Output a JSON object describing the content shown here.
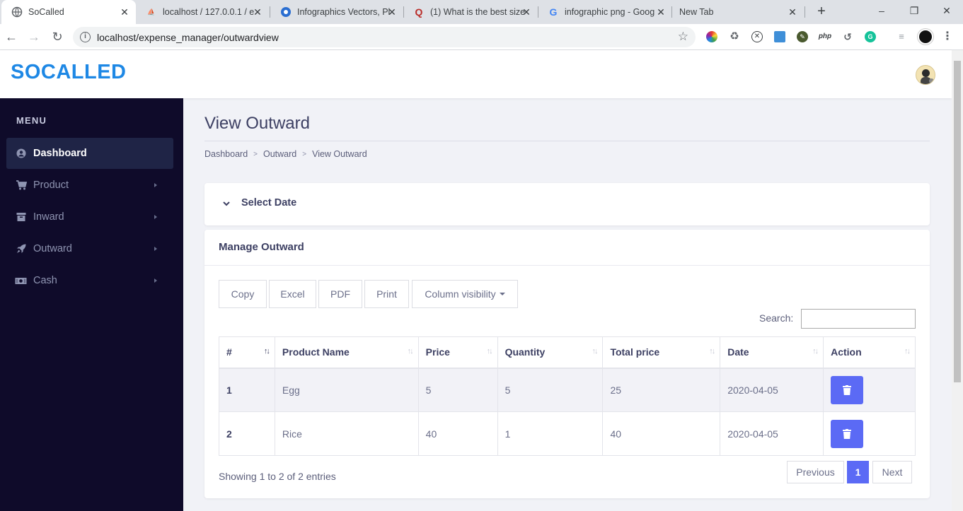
{
  "browser": {
    "tabs": [
      {
        "title": "SoCalled",
        "icon": "globe-icon"
      },
      {
        "title": "localhost / 127.0.0.1 / e",
        "icon": "phpmyadmin-icon"
      },
      {
        "title": "Infographics Vectors, Pl",
        "icon": "freepik-icon"
      },
      {
        "title": "(1) What is the best size",
        "icon": "quora-icon"
      },
      {
        "title": "infographic png - Goog",
        "icon": "google-icon"
      },
      {
        "title": "New Tab",
        "icon": ""
      }
    ],
    "url": "localhost/expense_manager/outwardview",
    "ext_php_label": "php"
  },
  "app": {
    "brand": "SOCALLED"
  },
  "sidebar": {
    "menu_title": "MENU",
    "items": [
      {
        "label": "Dashboard",
        "icon": "user-circle-icon",
        "active": true
      },
      {
        "label": "Product",
        "icon": "cart-icon"
      },
      {
        "label": "Inward",
        "icon": "inbox-icon"
      },
      {
        "label": "Outward",
        "icon": "rocket-icon"
      },
      {
        "label": "Cash",
        "icon": "money-icon"
      }
    ]
  },
  "page": {
    "title": "View Outward",
    "breadcrumb": [
      "Dashboard",
      "Outward",
      "View Outward"
    ],
    "select_date_label": "Select Date",
    "manage_title": "Manage Outward"
  },
  "datatable": {
    "buttons": [
      "Copy",
      "Excel",
      "PDF",
      "Print",
      "Column visibility"
    ],
    "search_label": "Search:",
    "search_value": "",
    "columns": [
      "#",
      "Product Name",
      "Price",
      "Quantity",
      "Total price",
      "Date",
      "Action"
    ],
    "rows": [
      {
        "num": "1",
        "product": "Egg",
        "price": "5",
        "quantity": "5",
        "total": "25",
        "date": "2020-04-05"
      },
      {
        "num": "2",
        "product": "Rice",
        "price": "40",
        "quantity": "1",
        "total": "40",
        "date": "2020-04-05"
      }
    ],
    "info": "Showing 1 to 2 of 2 entries",
    "pagination": {
      "previous": "Previous",
      "current": "1",
      "next": "Next"
    }
  },
  "colors": {
    "brand": "#1e88e5",
    "sidebar_bg": "#0f0b2a",
    "accent": "#5b6af5"
  }
}
